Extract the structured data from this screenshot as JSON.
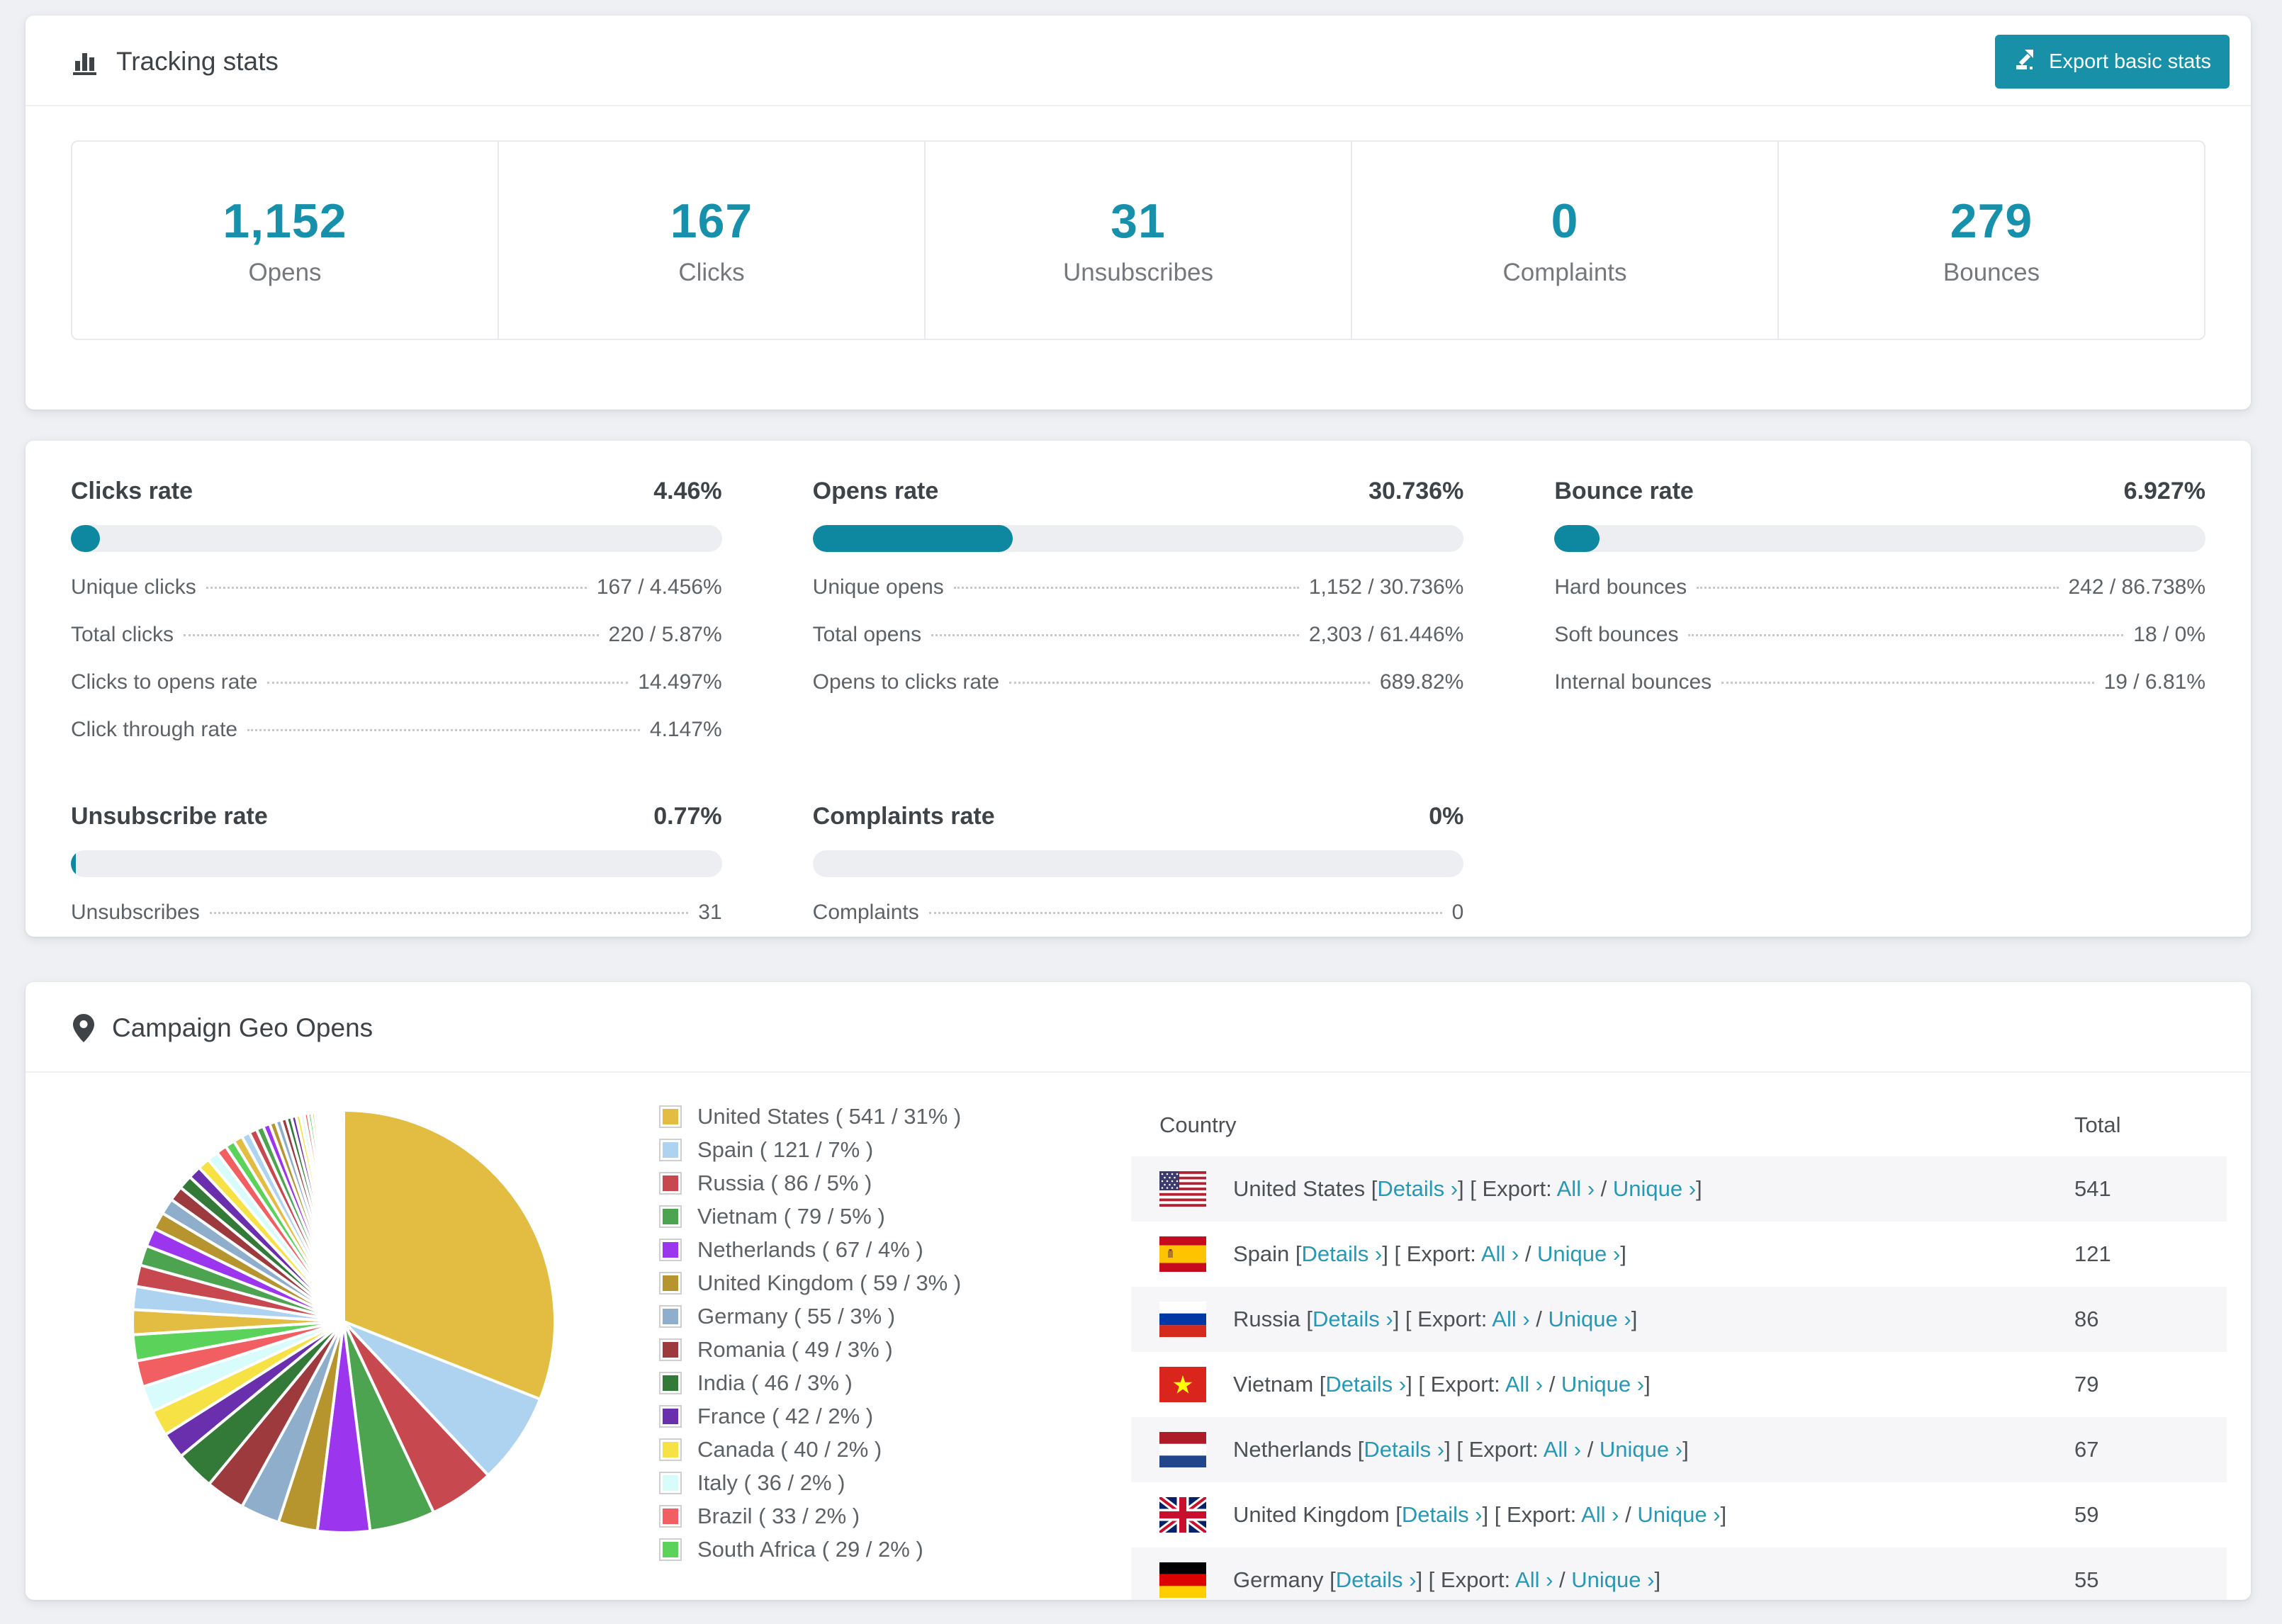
{
  "colors": {
    "accent_bar": "#0E87A1",
    "accent_number": "#1791AB",
    "accent_button": "#1790A8",
    "accent_link": "#2798B5",
    "page_background": "#eef0f3",
    "row_stripe": "#f6f6f8"
  },
  "tracking": {
    "title": "Tracking stats",
    "export_button": "Export basic stats",
    "stats": [
      {
        "value": "1,152",
        "label": "Opens"
      },
      {
        "value": "167",
        "label": "Clicks"
      },
      {
        "value": "31",
        "label": "Unsubscribes"
      },
      {
        "value": "0",
        "label": "Complaints"
      },
      {
        "value": "279",
        "label": "Bounces"
      }
    ]
  },
  "rates": {
    "sections": [
      {
        "title": "Clicks rate",
        "value": "4.46%",
        "percent": 4.46,
        "rows": [
          [
            "Unique clicks",
            "167 / 4.456%"
          ],
          [
            "Total clicks",
            "220 / 5.87%"
          ],
          [
            "Clicks to opens rate",
            "14.497%"
          ],
          [
            "Click through rate",
            "4.147%"
          ]
        ]
      },
      {
        "title": "Opens rate",
        "value": "30.736%",
        "percent": 30.736,
        "rows": [
          [
            "Unique opens",
            "1,152 / 30.736%"
          ],
          [
            "Total opens",
            "2,303 / 61.446%"
          ],
          [
            "Opens to clicks rate",
            "689.82%"
          ]
        ]
      },
      {
        "title": "Bounce rate",
        "value": "6.927%",
        "percent": 6.927,
        "rows": [
          [
            "Hard bounces",
            "242 / 86.738%"
          ],
          [
            "Soft bounces",
            "18 / 0%"
          ],
          [
            "Internal bounces",
            "19 / 6.81%"
          ]
        ]
      },
      {
        "title": "Unsubscribe rate",
        "value": "0.77%",
        "percent": 0.77,
        "rows": [
          [
            "Unsubscribes",
            "31"
          ]
        ]
      },
      {
        "title": "Complaints rate",
        "value": "0%",
        "percent": 0,
        "rows": [
          [
            "Complaints",
            "0"
          ]
        ]
      }
    ]
  },
  "geo": {
    "title": "Campaign Geo Opens",
    "chart_data": {
      "type": "pie",
      "title": "Campaign Geo Opens",
      "legend_position": "right",
      "legend_format": "{name} ( {value} / {percent}% )",
      "series": [
        {
          "name": "United States",
          "value": 541,
          "percent": 31,
          "color": "#E3BC42",
          "flag": "us"
        },
        {
          "name": "Spain",
          "value": 121,
          "percent": 7,
          "color": "#AED3F1",
          "flag": "es"
        },
        {
          "name": "Russia",
          "value": 86,
          "percent": 5,
          "color": "#C7494F",
          "flag": "ru"
        },
        {
          "name": "Vietnam",
          "value": 79,
          "percent": 5,
          "color": "#4CA450",
          "flag": "vn"
        },
        {
          "name": "Netherlands",
          "value": 67,
          "percent": 4,
          "color": "#9C36EE",
          "flag": "nl"
        },
        {
          "name": "United Kingdom",
          "value": 59,
          "percent": 3,
          "color": "#B6952F",
          "flag": "gb"
        },
        {
          "name": "Germany",
          "value": 55,
          "percent": 3,
          "color": "#8FAECB",
          "flag": "de"
        },
        {
          "name": "Romania",
          "value": 49,
          "percent": 3,
          "color": "#9C3A3E"
        },
        {
          "name": "India",
          "value": 46,
          "percent": 3,
          "color": "#337A39"
        },
        {
          "name": "France",
          "value": 42,
          "percent": 2,
          "color": "#6A2FAC"
        },
        {
          "name": "Canada",
          "value": 40,
          "percent": 2,
          "color": "#F6E244"
        },
        {
          "name": "Italy",
          "value": 36,
          "percent": 2,
          "color": "#D8FBFB"
        },
        {
          "name": "Brazil",
          "value": 33,
          "percent": 2,
          "color": "#F25F63"
        },
        {
          "name": "South Africa",
          "value": 29,
          "percent": 2,
          "color": "#5BD35B"
        }
      ],
      "others": {
        "total_percent": 26,
        "count": 44,
        "decay": 0.93,
        "note": "many small unlabeled country slices"
      }
    },
    "table": {
      "columns": [
        "Country",
        "Total"
      ],
      "links": {
        "bracket_open": "[",
        "bracket_close": "]",
        "details": "Details ›",
        "export": "Export:",
        "all": "All ›",
        "slash": "/",
        "unique": "Unique ›"
      },
      "rows": [
        {
          "country": "United States",
          "flag": "us",
          "total": "541"
        },
        {
          "country": "Spain",
          "flag": "es",
          "total": "121"
        },
        {
          "country": "Russia",
          "flag": "ru",
          "total": "86"
        },
        {
          "country": "Vietnam",
          "flag": "vn",
          "total": "79"
        },
        {
          "country": "Netherlands",
          "flag": "nl",
          "total": "67"
        },
        {
          "country": "United Kingdom",
          "flag": "gb",
          "total": "59"
        },
        {
          "country": "Germany",
          "flag": "de",
          "total": "55"
        }
      ]
    }
  }
}
